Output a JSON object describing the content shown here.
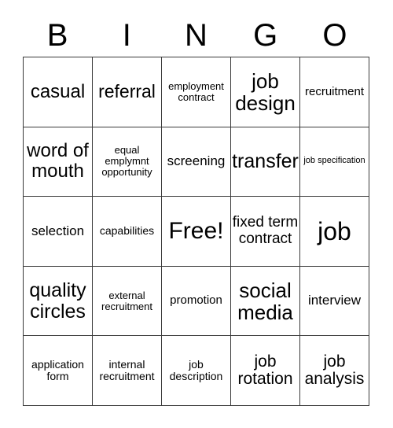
{
  "card": {
    "header": {
      "letters": [
        "B",
        "I",
        "N",
        "G",
        "O"
      ]
    },
    "free_space_label": "Free!",
    "rows": [
      [
        {
          "label": "casual",
          "size": 24
        },
        {
          "label": "referral",
          "size": 23
        },
        {
          "label": "employment contract",
          "size": 13
        },
        {
          "label": "job design",
          "size": 26
        },
        {
          "label": "recruitment",
          "size": 15
        }
      ],
      [
        {
          "label": "word of mouth",
          "size": 24
        },
        {
          "label": "equal emplymnt opportunity",
          "size": 13
        },
        {
          "label": "screening",
          "size": 17
        },
        {
          "label": "transfer",
          "size": 25
        },
        {
          "label": "job specification",
          "size": 11
        }
      ],
      [
        {
          "label": "selection",
          "size": 17
        },
        {
          "label": "capabilities",
          "size": 14
        },
        {
          "label": "Free!",
          "size": 30
        },
        {
          "label": "fixed term contract",
          "size": 19
        },
        {
          "label": "job",
          "size": 32
        }
      ],
      [
        {
          "label": "quality circles",
          "size": 25
        },
        {
          "label": "external recruitment",
          "size": 13
        },
        {
          "label": "promotion",
          "size": 15
        },
        {
          "label": "social media",
          "size": 26
        },
        {
          "label": "interview",
          "size": 17
        }
      ],
      [
        {
          "label": "application form",
          "size": 14
        },
        {
          "label": "internal recruitment",
          "size": 14
        },
        {
          "label": "job description",
          "size": 14
        },
        {
          "label": "job rotation",
          "size": 21
        },
        {
          "label": "job analysis",
          "size": 21
        }
      ]
    ]
  },
  "colors": {
    "border": "#3a3a3a",
    "text": "#000000",
    "background": "#ffffff"
  }
}
